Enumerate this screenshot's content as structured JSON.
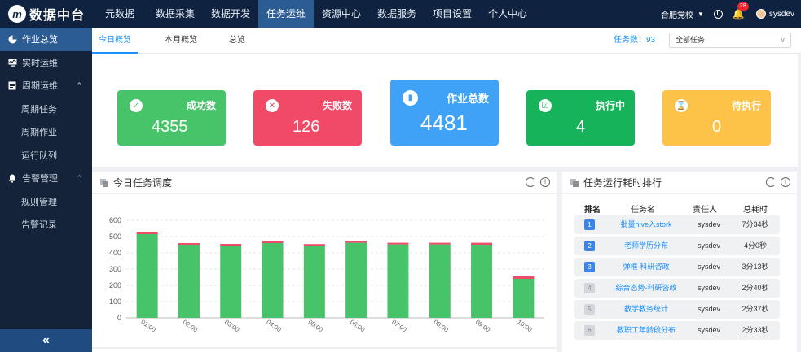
{
  "app": {
    "logo_mark": "m",
    "title": "数据中台"
  },
  "nav": [
    "元数据",
    "数据采集",
    "数据开发",
    "任务运维",
    "资源中心",
    "数据服务",
    "项目设置",
    "个人中心"
  ],
  "nav_active_index": 3,
  "topright": {
    "school": "合肥党校",
    "caret": "▼",
    "notification_count": "28",
    "user": "sysdev"
  },
  "sidebar": {
    "items": [
      {
        "label": "作业总览",
        "icon": "dashboard-icon"
      },
      {
        "label": "实时运维",
        "icon": "monitor-icon"
      },
      {
        "label": "周期运维",
        "icon": "document-icon",
        "arrow": "⌃"
      },
      {
        "label": "周期任务"
      },
      {
        "label": "周期作业"
      },
      {
        "label": "运行队列"
      },
      {
        "label": "告警管理",
        "icon": "bell-icon",
        "arrow": "⌃"
      },
      {
        "label": "规则管理"
      },
      {
        "label": "告警记录"
      }
    ],
    "collapse_label": "«"
  },
  "tabs": [
    "今日概览",
    "本月概览",
    "总览"
  ],
  "task_count": "任务数：93",
  "task_filter": {
    "value": "全部任务",
    "caret": "∨"
  },
  "stat_cards": [
    {
      "label": "成功数",
      "value": "4355",
      "icon": "check-icon",
      "glyph": "✓",
      "color": "#47c46a"
    },
    {
      "label": "失败数",
      "value": "126",
      "icon": "close-icon",
      "glyph": "✕",
      "color": "#f04a67"
    },
    {
      "label": "作业总数",
      "value": "4481",
      "icon": "bar-chart-icon",
      "glyph": "▮",
      "color": "#3fa2f7"
    },
    {
      "label": "执行中",
      "value": "4",
      "icon": "running-icon",
      "glyph": "☑",
      "color": "#17b35a"
    },
    {
      "label": "待执行",
      "value": "0",
      "icon": "hourglass-icon",
      "glyph": "⌛",
      "color": "#fcc348"
    }
  ],
  "schedule_panel": {
    "title": "今日任务调度"
  },
  "ranking_panel": {
    "title": "任务运行耗时排行",
    "headers": [
      "排名",
      "任务名",
      "责任人",
      "总耗时"
    ],
    "rows": [
      {
        "rank": "1",
        "name": "批量hive入stork",
        "owner": "sysdev",
        "time": "7分34秒"
      },
      {
        "rank": "2",
        "name": "老师学历分布",
        "owner": "sysdev",
        "time": "4分0秒"
      },
      {
        "rank": "3",
        "name": "弹框-科研咨政",
        "owner": "sysdev",
        "time": "3分13秒"
      },
      {
        "rank": "4",
        "name": "综合态势-科研咨政",
        "owner": "sysdev",
        "time": "2分40秒"
      },
      {
        "rank": "5",
        "name": "教学教务统计",
        "owner": "sysdev",
        "time": "2分37秒"
      },
      {
        "rank": "6",
        "name": "教职工年龄段分布",
        "owner": "sysdev",
        "time": "2分33秒"
      }
    ]
  },
  "chart_data": {
    "type": "bar",
    "stacked": true,
    "categories": [
      "01:00",
      "02:00",
      "03:00",
      "04:00",
      "05:00",
      "06:00",
      "07:00",
      "08:00",
      "09:00",
      "10:00"
    ],
    "series": [
      {
        "values": [
          515,
          450,
          445,
          460,
          442,
          462,
          452,
          452,
          450,
          240
        ],
        "color": "#47c46a"
      },
      {
        "values": [
          15,
          10,
          10,
          10,
          12,
          10,
          10,
          10,
          12,
          15
        ],
        "color": "#ee4d67"
      }
    ],
    "ylim": [
      0,
      600
    ],
    "yticks": [
      0,
      100,
      200,
      300,
      400,
      500,
      600
    ],
    "grid": true,
    "title": "",
    "xlabel": "",
    "ylabel": ""
  }
}
